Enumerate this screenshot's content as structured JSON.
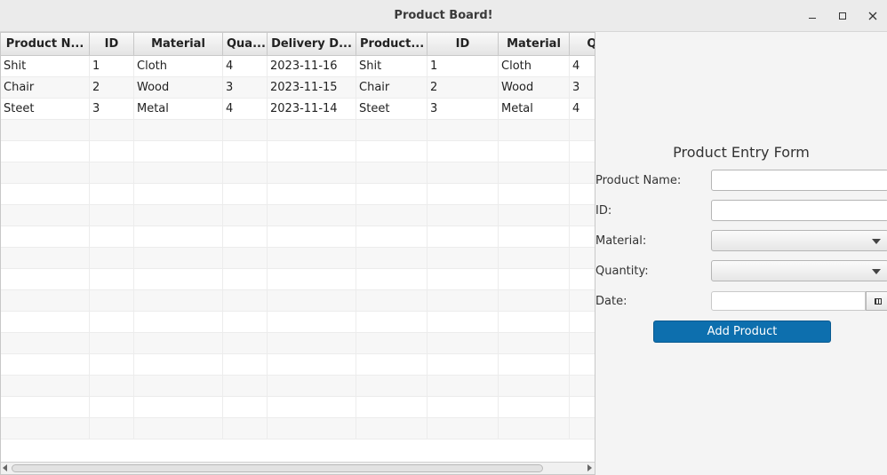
{
  "window": {
    "title": "Product Board!"
  },
  "table": {
    "headers": [
      "Product N...",
      "ID",
      "Material",
      "Qua...",
      "Delivery D...",
      "Product...",
      "ID",
      "Material",
      "Qu"
    ],
    "rows": [
      [
        "Shit",
        "1",
        "Cloth",
        "4",
        "2023-11-16",
        "Shit",
        "1",
        "Cloth",
        "4"
      ],
      [
        "Chair",
        "2",
        "Wood",
        "3",
        "2023-11-15",
        "Chair",
        "2",
        "Wood",
        "3"
      ],
      [
        "Steet",
        "3",
        "Metal",
        "4",
        "2023-11-14",
        "Steet",
        "3",
        "Metal",
        "4"
      ]
    ]
  },
  "form": {
    "title": "Product Entry Form",
    "product_name_label": "Product Name:",
    "product_name_value": "",
    "id_label": "ID:",
    "id_value": "",
    "material_label": "Material:",
    "material_value": "",
    "quantity_label": "Quantity:",
    "quantity_value": "",
    "date_label": "Date:",
    "date_value": "",
    "add_button": "Add Product"
  },
  "colors": {
    "accent": "#0d6fae"
  }
}
